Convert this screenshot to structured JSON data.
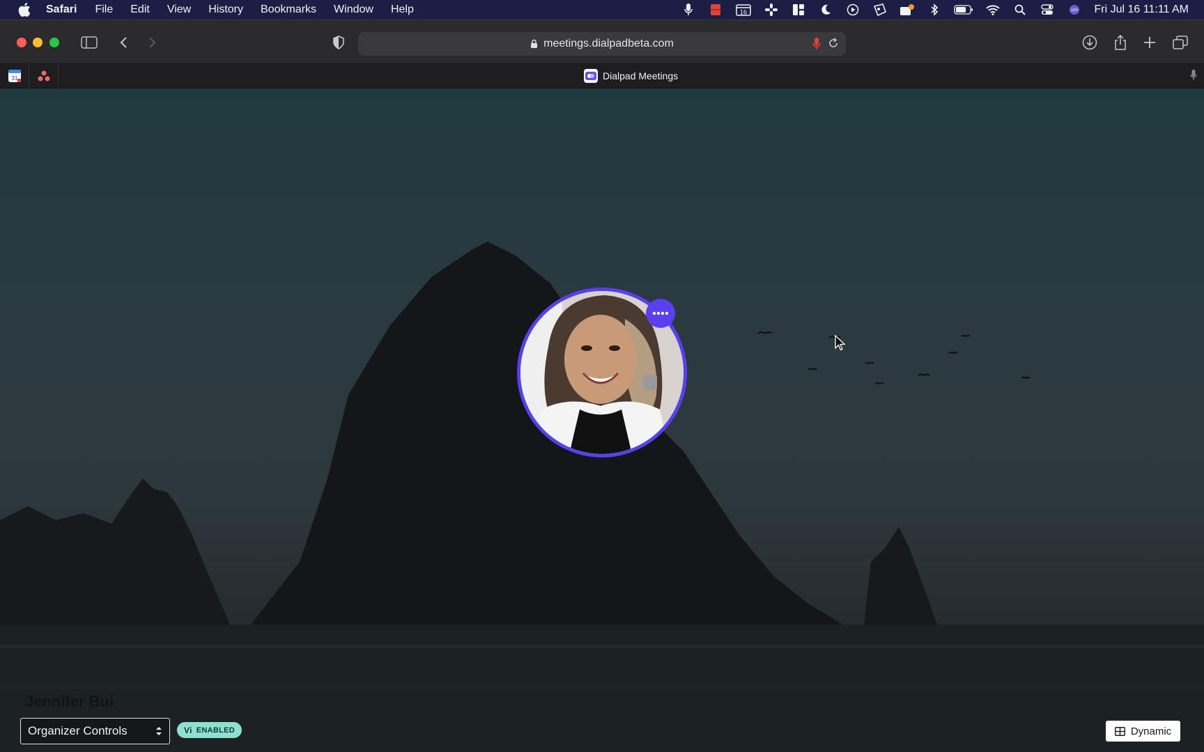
{
  "menubar": {
    "app_name": "Safari",
    "items": [
      "File",
      "Edit",
      "View",
      "History",
      "Bookmarks",
      "Window",
      "Help"
    ],
    "clock": "Fri Jul 16  11:11 AM",
    "calendar_day": "16"
  },
  "browser": {
    "url": "meetings.dialpadbeta.com",
    "pinned_calendar_day": "31",
    "active_tab_title": "Dialpad Meetings"
  },
  "meeting": {
    "participant_name": "Jennifer Bui",
    "organizer_controls_label": "Organizer Controls",
    "vi_badge": {
      "prefix": "Vi",
      "label": "ENABLED"
    },
    "layout_button_label": "Dynamic",
    "accent_color": "#5a3ff0",
    "badge_color": "#8fe0cf"
  }
}
